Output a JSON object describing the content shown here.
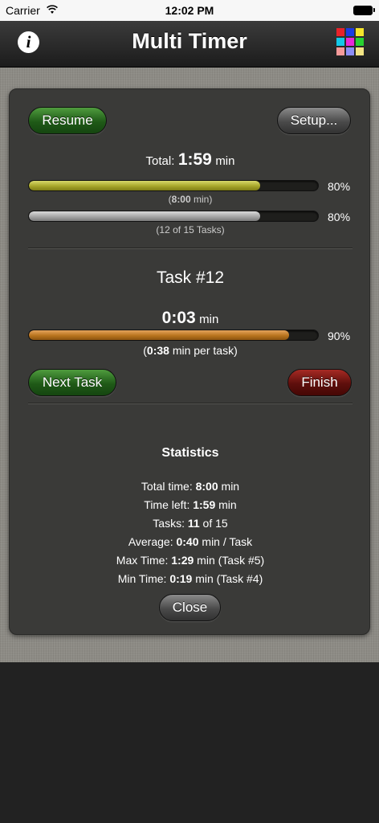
{
  "status": {
    "carrier": "Carrier",
    "time": "12:02 PM"
  },
  "nav": {
    "info_label": "i",
    "title": "Multi Timer",
    "palette_colors": [
      "#e8222a",
      "#1b3be6",
      "#f6e52b",
      "#13c8e8",
      "#e829d8",
      "#27d130",
      "#f59a9a",
      "#8e8ef6",
      "#f3e585"
    ]
  },
  "controls": {
    "resume": "Resume",
    "setup": "Setup...",
    "next_task": "Next Task",
    "finish": "Finish",
    "close": "Close"
  },
  "total": {
    "label": "Total:",
    "value": "1:59",
    "unit": "min",
    "time_progress": 0.8,
    "time_pct": "80%",
    "time_sub_pre": "(",
    "time_sub_bold": "8:00",
    "time_sub_post": " min)",
    "tasks_progress": 0.8,
    "tasks_pct": "80%",
    "tasks_sub": "(12 of 15 Tasks)"
  },
  "task": {
    "title": "Task #12",
    "value": "0:03",
    "unit": "min",
    "progress": 0.9,
    "pct": "90%",
    "sub_pre": "(",
    "sub_bold": "0:38",
    "sub_post": " min per task)"
  },
  "stats": {
    "heading": "Statistics",
    "rows": [
      {
        "label": "Total time:",
        "bold": "8:00",
        "rest": " min"
      },
      {
        "label": "Time left:",
        "bold": "1:59",
        "rest": " min"
      },
      {
        "label": "Tasks:",
        "bold": "11",
        "rest": " of 15"
      },
      {
        "label": "Average:",
        "bold": "0:40",
        "rest": " min / Task"
      },
      {
        "label": "Max Time:",
        "bold": "1:29",
        "rest": " min (Task #5)"
      },
      {
        "label": "Min Time:",
        "bold": "0:19",
        "rest": " min (Task #4)"
      }
    ]
  }
}
